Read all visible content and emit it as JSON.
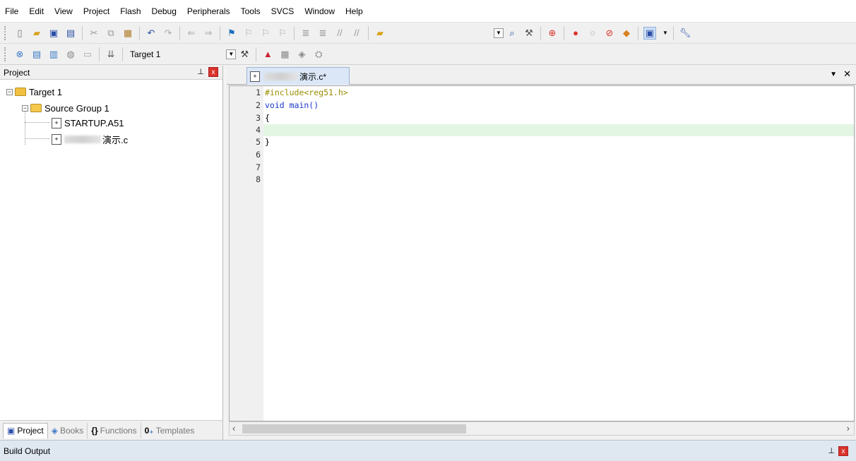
{
  "menu": [
    "File",
    "Edit",
    "View",
    "Project",
    "Flash",
    "Debug",
    "Peripherals",
    "Tools",
    "SVCS",
    "Window",
    "Help"
  ],
  "toolbar": {
    "target_name": "Target 1"
  },
  "project_pane": {
    "title": "Project",
    "pin_glyph": "\u0004",
    "close_glyph": "x",
    "tree": {
      "target": "Target 1",
      "group": "Source Group 1",
      "files": [
        "STARTUP.A51",
        "演示.c"
      ]
    },
    "tabs": [
      {
        "label": "Project",
        "icon": "project-icon"
      },
      {
        "label": "Books",
        "icon": "books-icon"
      },
      {
        "label": "Functions",
        "icon": "braces-icon"
      },
      {
        "label": "Templates",
        "icon": "templates-icon"
      }
    ]
  },
  "editor": {
    "tab_label": "演示.c*",
    "lines": [
      {
        "num": "1",
        "text": "#include<reg51.h>"
      },
      {
        "num": "2",
        "text": "void main()"
      },
      {
        "num": "3",
        "text": "{"
      },
      {
        "num": "4",
        "text": ""
      },
      {
        "num": "5",
        "text": "}"
      },
      {
        "num": "6",
        "text": ""
      },
      {
        "num": "7",
        "text": ""
      },
      {
        "num": "8",
        "text": ""
      }
    ],
    "current_line": 4
  },
  "build_output": {
    "title": "Build Output"
  },
  "colors": {
    "tab_active": "#dbe7f7",
    "current_line": "#e3f6e3",
    "close_red": "#d9322b",
    "keyword_blue": "#1838c8",
    "include_olive": "#9a8d00"
  }
}
